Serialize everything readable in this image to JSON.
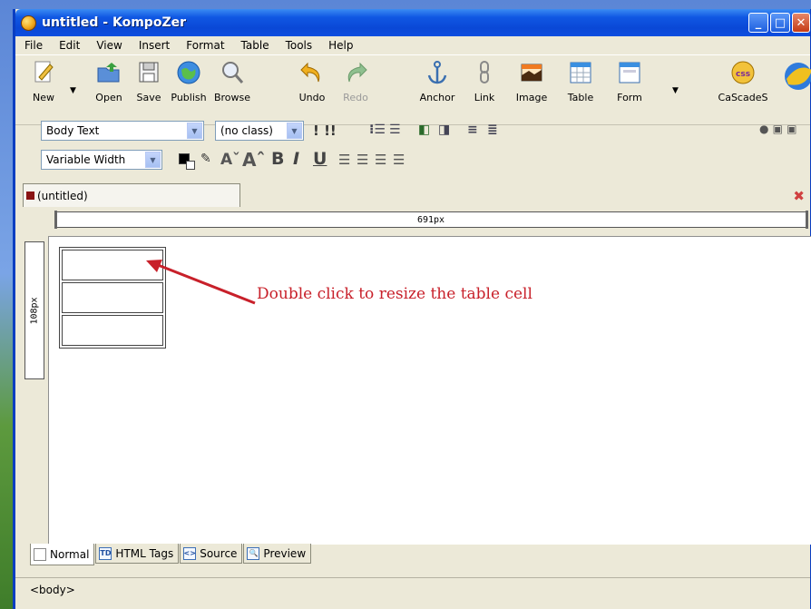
{
  "window": {
    "title": "untitled - KompoZer"
  },
  "menu": [
    "File",
    "Edit",
    "View",
    "Insert",
    "Format",
    "Table",
    "Tools",
    "Help"
  ],
  "toolbar": {
    "buttons": [
      {
        "label": "New",
        "icon": "new-page-icon"
      },
      {
        "label": "Open",
        "icon": "open-folder-icon"
      },
      {
        "label": "Save",
        "icon": "floppy-disk-icon"
      },
      {
        "label": "Publish",
        "icon": "globe-icon"
      },
      {
        "label": "Browse",
        "icon": "magnifier-icon"
      },
      {
        "label": "Undo",
        "icon": "undo-arrow-icon"
      },
      {
        "label": "Redo",
        "icon": "redo-arrow-icon",
        "disabled": true
      },
      {
        "label": "Anchor",
        "icon": "anchor-icon"
      },
      {
        "label": "Link",
        "icon": "chain-link-icon"
      },
      {
        "label": "Image",
        "icon": "image-icon"
      },
      {
        "label": "Table",
        "icon": "table-icon"
      },
      {
        "label": "Form",
        "icon": "form-icon"
      },
      {
        "label": "CaScadeS",
        "icon": "css-icon"
      }
    ]
  },
  "format": {
    "paragraph_style": "Body Text",
    "class": "(no class)",
    "font": "Variable Width"
  },
  "tab": {
    "title": "(untitled)"
  },
  "rulers": {
    "horizontal": "691px",
    "vertical": "108px"
  },
  "annotation": {
    "text": "Double click to resize the table cell",
    "color": "#c8202a"
  },
  "view_tabs": [
    "Normal",
    "HTML Tags",
    "Source",
    "Preview"
  ],
  "status": {
    "path": "<body>"
  },
  "colors": {
    "titlebar": "#0a48d6",
    "chrome": "#ece9d8",
    "annotation": "#c8202a"
  }
}
